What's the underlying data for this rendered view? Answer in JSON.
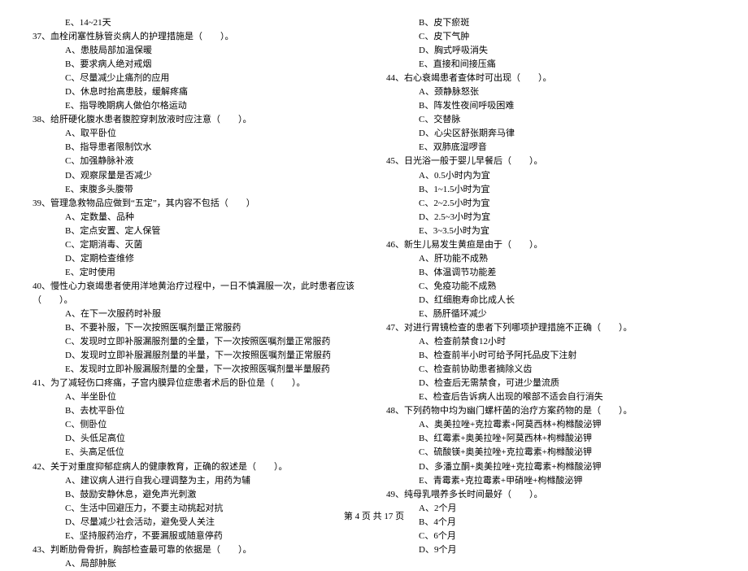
{
  "left": {
    "pre_opt": "E、14~21天",
    "q37": {
      "stem": "37、血栓闭塞性脉管炎病人的护理措施是（　　）。",
      "opts": [
        "A、患肢局部加温保暖",
        "B、要求病人绝对戒烟",
        "C、尽量减少止痛剂的应用",
        "D、休息时抬高患肢，缓解疼痛",
        "E、指导晚期病人做伯尔格运动"
      ]
    },
    "q38": {
      "stem": "38、给肝硬化腹水患者腹腔穿刺放液时应注意（　　）。",
      "opts": [
        "A、取平卧位",
        "B、指导患者限制饮水",
        "C、加强静脉补液",
        "D、观察尿量是否减少",
        "E、束腹多头腹带"
      ]
    },
    "q39": {
      "stem": "39、管理急救物品应做到“五定”，其内容不包括（　　）",
      "opts": [
        "A、定数量、品种",
        "B、定点安置、定人保管",
        "C、定期消毒、灭菌",
        "D、定期检查维修",
        "E、定时使用"
      ]
    },
    "q40": {
      "stem": "40、慢性心力衰竭患者使用洋地黄治疗过程中，一日不慎漏服一次，此时患者应该（　　）。",
      "opts": [
        "A、在下一次服药时补服",
        "B、不要补服，下一次按照医嘱剂量正常服药",
        "C、发现时立即补服漏服剂量的全量，下一次按照医嘱剂量正常服药",
        "D、发现时立即补服漏服剂量的半量，下一次按照医嘱剂量正常服药",
        "E、发现时立即补服漏服剂量的全量，下一次按照医嘱剂量半量服药"
      ]
    },
    "q41": {
      "stem": "41、为了减轻伤口疼痛，子宫内膜异位症患者术后的卧位是（　　）。",
      "opts": [
        "A、半坐卧位",
        "B、去枕平卧位",
        "C、侧卧位",
        "D、头低足高位",
        "E、头高足低位"
      ]
    },
    "q42": {
      "stem": "42、关于对重度抑郁症病人的健康教育，正确的叙述是（　　）。",
      "opts": [
        "A、建议病人进行自我心理调整为主，用药为辅",
        "B、鼓励安静休息，避免声光刺激",
        "C、生活中回避压力，不要主动挑起对抗",
        "D、尽量减少社会活动，避免受人关注",
        "E、坚持服药治疗，不要漏服或随意停药"
      ]
    },
    "q43": {
      "stem": "43、判断肋骨骨折，胸部检查最可靠的依据是（　　）。",
      "opts": [
        "A、局部肿胀"
      ]
    }
  },
  "right": {
    "pre_opts": [
      "B、皮下瘀斑",
      "C、皮下气肿",
      "D、胸式呼吸消失",
      "E、直接和间接压痛"
    ],
    "q44": {
      "stem": "44、右心衰竭患者查体时可出现（　　）。",
      "opts": [
        "A、颈静脉怒张",
        "B、阵发性夜间呼吸困难",
        "C、交替脉",
        "D、心尖区舒张期奔马律",
        "E、双肺底湿啰音"
      ]
    },
    "q45": {
      "stem": "45、日光浴一般于婴儿早餐后（　　）。",
      "opts": [
        "A、0.5小时内为宜",
        "B、1~1.5小时为宜",
        "C、2~2.5小时为宜",
        "D、2.5~3小时为宜",
        "E、3~3.5小时为宜"
      ]
    },
    "q46": {
      "stem": "46、新生儿易发生黄疸是由于（　　）。",
      "opts": [
        "A、肝功能不成熟",
        "B、体温调节功能差",
        "C、免疫功能不成熟",
        "D、红细胞寿命比成人长",
        "E、肠肝循环减少"
      ]
    },
    "q47": {
      "stem": "47、对进行胃镜检查的患者下列哪项护理措施不正确（　　）。",
      "opts": [
        "A、检查前禁食12小时",
        "B、检查前半小时可给予阿托品皮下注射",
        "C、检查前协助患者摘除义齿",
        "D、检查后无需禁食，可进少量流质",
        "E、检查后告诉病人出现的喉部不适会自行消失"
      ]
    },
    "q48": {
      "stem": "48、下列药物中均为幽门螺杆菌的治疗方案药物的是（　　）。",
      "opts": [
        "A、奥美拉唑+克拉霉素+阿莫西林+枸橼酸泌钾",
        "B、红霉素+奥美拉唑+阿莫西林+枸橼酸泌钾",
        "C、硫酸镁+奥美拉唑+克拉霉素+枸橼酸泌钾",
        "D、多潘立酮+奥美拉唑+克拉霉素+枸橼酸泌钾",
        "E、青霉素+克拉霉素+甲硝唑+枸橼酸泌钾"
      ]
    },
    "q49": {
      "stem": "49、纯母乳喂养多长时间最好（　　）。",
      "opts": [
        "A、2个月",
        "B、4个月",
        "C、6个月",
        "D、9个月"
      ]
    }
  },
  "footer": "第 4 页 共 17 页"
}
